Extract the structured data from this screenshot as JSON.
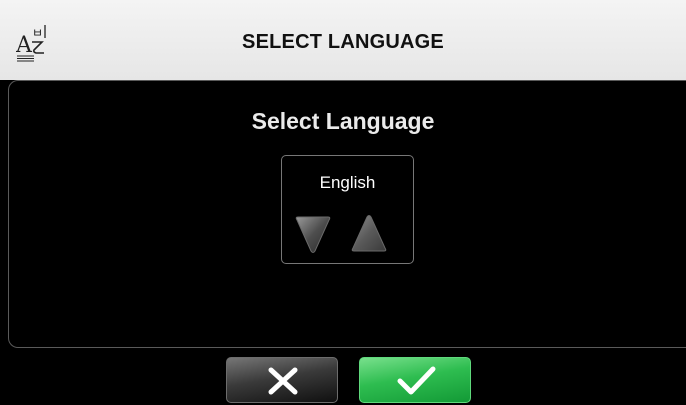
{
  "header": {
    "title": "SELECT LANGUAGE",
    "icon": "language-icon"
  },
  "dialog": {
    "title": "Select Language"
  },
  "language_selector": {
    "current_value": "English",
    "down_icon": "triangle-down-icon",
    "up_icon": "triangle-up-icon"
  },
  "actions": {
    "cancel_icon": "close-icon",
    "confirm_icon": "checkmark-icon",
    "confirm_color": "#2ebd50"
  }
}
